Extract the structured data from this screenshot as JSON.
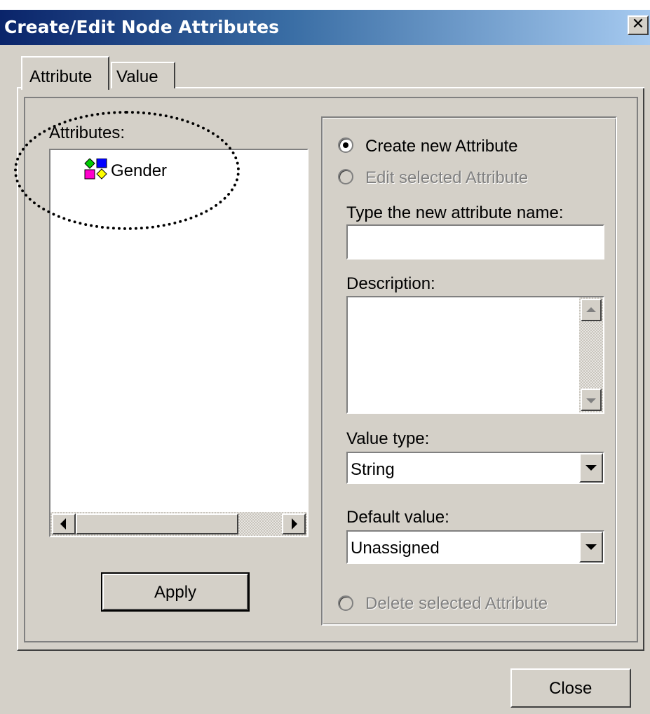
{
  "window": {
    "title": "Create/Edit Node Attributes",
    "close_glyph": "✕"
  },
  "tabs": [
    {
      "label": "Attribute",
      "active": true
    },
    {
      "label": "Value",
      "active": false
    }
  ],
  "attributes_panel": {
    "label": "Attributes:",
    "items": [
      {
        "label": "Gender",
        "icon": "attribute-shapes-icon"
      }
    ],
    "apply_label": "Apply"
  },
  "editor": {
    "create_radio": {
      "label": "Create new Attribute",
      "checked": true,
      "enabled": true
    },
    "edit_radio": {
      "label": "Edit selected Attribute",
      "checked": false,
      "enabled": false
    },
    "name_label": "Type the new attribute name:",
    "name_value": "",
    "description_label": "Description:",
    "description_value": "",
    "value_type_label": "Value type:",
    "value_type_selected": "String",
    "default_value_label": "Default value:",
    "default_value_selected": "Unassigned",
    "delete_radio": {
      "label": "Delete selected Attribute",
      "checked": false,
      "enabled": false
    }
  },
  "footer": {
    "close_label": "Close"
  },
  "colors": {
    "face": "#d4d0c8",
    "title_start": "#0a246a",
    "title_end": "#a6caf0",
    "disabled_text": "#808080"
  }
}
